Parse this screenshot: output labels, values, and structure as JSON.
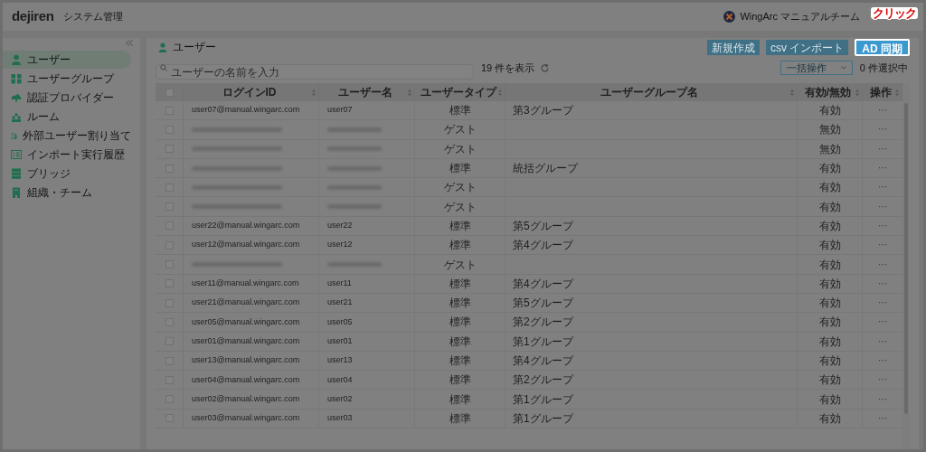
{
  "header": {
    "logo": "dejiren",
    "title": "システム管理",
    "account": "WingArc マニュアルチーム"
  },
  "annotation": {
    "text": "クリック"
  },
  "sidebar": {
    "items": [
      {
        "label": "ユーザー",
        "selected": true
      },
      {
        "label": "ユーザーグループ",
        "selected": false
      },
      {
        "label": "認証プロバイダー",
        "selected": false
      },
      {
        "label": "ルーム",
        "selected": false
      },
      {
        "label": "外部ユーザー割り当て",
        "selected": false
      },
      {
        "label": "インポート実行履歴",
        "selected": false
      },
      {
        "label": "ブリッジ",
        "selected": false
      },
      {
        "label": "組織・チーム",
        "selected": false
      }
    ]
  },
  "page": {
    "title": "ユーザー",
    "buttons": [
      {
        "label": "新規作成",
        "highlighted": false
      },
      {
        "label": "csv インポート",
        "highlighted": false
      },
      {
        "label": "AD 同期",
        "highlighted": true
      }
    ],
    "search": {
      "placeholder": "ユーザーの名前を入力"
    },
    "count": "19 件を表示",
    "bulk_action": {
      "placeholder": "一括操作"
    },
    "selection": "0 件選択中"
  },
  "table": {
    "header_checked": false,
    "columns": [
      "ログインID",
      "ユーザー名",
      "ユーザータイプ",
      "ユーザーグループ名",
      "有効/無効",
      "操作"
    ],
    "rows": [
      {
        "checked": false,
        "redacted": false,
        "login_id": "user07@manual.wingarc.com",
        "user_name": "user07",
        "type": "標準",
        "group": "第3グループ",
        "status": "有効",
        "actions": "···"
      },
      {
        "checked": false,
        "redacted": true,
        "type": "ゲスト",
        "status": "無効",
        "actions": "···"
      },
      {
        "checked": false,
        "redacted": true,
        "type": "ゲスト",
        "status": "無効",
        "actions": "···"
      },
      {
        "checked": false,
        "redacted": true,
        "type": "標準",
        "group": "統括グループ",
        "status": "有効",
        "actions": "···"
      },
      {
        "checked": false,
        "redacted": true,
        "type": "ゲスト",
        "status": "有効",
        "actions": "···"
      },
      {
        "checked": false,
        "redacted": true,
        "type": "ゲスト",
        "status": "有効",
        "actions": "···"
      },
      {
        "checked": false,
        "redacted": false,
        "login_id": "user22@manual.wingarc.com",
        "user_name": "user22",
        "type": "標準",
        "group": "第5グループ",
        "status": "有効",
        "actions": "···"
      },
      {
        "checked": false,
        "redacted": false,
        "login_id": "user12@manual.wingarc.com",
        "user_name": "user12",
        "type": "標準",
        "group": "第4グループ",
        "status": "有効",
        "actions": "···"
      },
      {
        "checked": false,
        "redacted": true,
        "type": "ゲスト",
        "status": "有効",
        "actions": "···"
      },
      {
        "checked": false,
        "redacted": false,
        "login_id": "user11@manual.wingarc.com",
        "user_name": "user11",
        "type": "標準",
        "group": "第4グループ",
        "status": "有効",
        "actions": "···"
      },
      {
        "checked": false,
        "redacted": false,
        "login_id": "user21@manual.wingarc.com",
        "user_name": "user21",
        "type": "標準",
        "group": "第5グループ",
        "status": "有効",
        "actions": "···"
      },
      {
        "checked": false,
        "redacted": false,
        "login_id": "user05@manual.wingarc.com",
        "user_name": "user05",
        "type": "標準",
        "group": "第2グループ",
        "status": "有効",
        "actions": "···"
      },
      {
        "checked": false,
        "redacted": false,
        "login_id": "user01@manual.wingarc.com",
        "user_name": "user01",
        "type": "標準",
        "group": "第1グループ",
        "status": "有効",
        "actions": "···"
      },
      {
        "checked": false,
        "redacted": false,
        "login_id": "user13@manual.wingarc.com",
        "user_name": "user13",
        "type": "標準",
        "group": "第4グループ",
        "status": "有効",
        "actions": "···"
      },
      {
        "checked": false,
        "redacted": false,
        "login_id": "user04@manual.wingarc.com",
        "user_name": "user04",
        "type": "標準",
        "group": "第2グループ",
        "status": "有効",
        "actions": "···"
      },
      {
        "checked": false,
        "redacted": false,
        "login_id": "user02@manual.wingarc.com",
        "user_name": "user02",
        "type": "標準",
        "group": "第1グループ",
        "status": "有効",
        "actions": "···"
      },
      {
        "checked": false,
        "redacted": false,
        "login_id": "user03@manual.wingarc.com",
        "user_name": "user03",
        "type": "標準",
        "group": "第1グループ",
        "status": "有効",
        "actions": "···"
      }
    ]
  }
}
